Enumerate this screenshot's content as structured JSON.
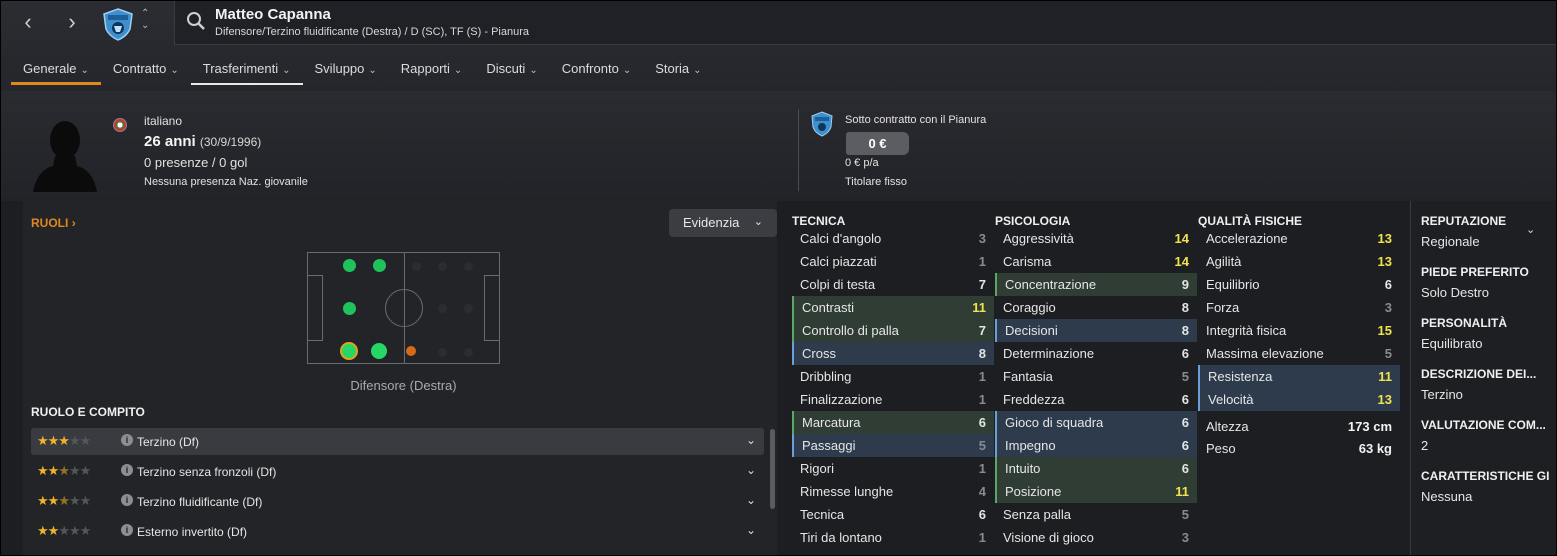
{
  "header": {
    "player_name": "Matteo Capanna",
    "player_roles": "Difensore/Terzino fluidificante (Destra) / D (SC), TF (S) - Pianura",
    "tabs": [
      {
        "label": "Generale"
      },
      {
        "label": "Contratto"
      },
      {
        "label": "Trasferimenti"
      },
      {
        "label": "Sviluppo"
      },
      {
        "label": "Rapporti"
      },
      {
        "label": "Discuti"
      },
      {
        "label": "Confronto"
      },
      {
        "label": "Storia"
      }
    ]
  },
  "profile": {
    "nationality": "italiano",
    "age": "26 anni",
    "birthdate": "(30/9/1996)",
    "appearances": "0 presenze / 0 gol",
    "youth_caps": "Nessuna presenza Naz. giovanile",
    "contract_with": "Sotto contratto con il Pianura",
    "value": "0 €",
    "wage": "0 € p/a",
    "squad_status": "Titolare fisso"
  },
  "roles_panel": {
    "title": "RUOLI",
    "highlight_button": "Evidenzia",
    "pitch_caption": "Difensore (Destra)",
    "role_section_title": "RUOLO E COMPITO",
    "roles": [
      {
        "name": "Terzino (Df)",
        "stars": 3
      },
      {
        "name": "Terzino senza fronzoli (Df)",
        "stars": 2.5
      },
      {
        "name": "Terzino fluidificante (Df)",
        "stars": 2.5
      },
      {
        "name": "Esterno invertito (Df)",
        "stars": 2
      }
    ]
  },
  "attributes": {
    "technical": {
      "title": "TECNICA",
      "items": [
        {
          "name": "Calci d'angolo",
          "value": "3"
        },
        {
          "name": "Calci piazzati",
          "value": "1"
        },
        {
          "name": "Colpi di testa",
          "value": "7"
        },
        {
          "name": "Contrasti",
          "value": "11"
        },
        {
          "name": "Controllo di palla",
          "value": "7"
        },
        {
          "name": "Cross",
          "value": "8"
        },
        {
          "name": "Dribbling",
          "value": "1"
        },
        {
          "name": "Finalizzazione",
          "value": "1"
        },
        {
          "name": "Marcatura",
          "value": "6"
        },
        {
          "name": "Passaggi",
          "value": "5"
        },
        {
          "name": "Rigori",
          "value": "1"
        },
        {
          "name": "Rimesse lunghe",
          "value": "4"
        },
        {
          "name": "Tecnica",
          "value": "6"
        },
        {
          "name": "Tiri da lontano",
          "value": "1"
        }
      ]
    },
    "mental": {
      "title": "PSICOLOGIA",
      "items": [
        {
          "name": "Aggressività",
          "value": "14"
        },
        {
          "name": "Carisma",
          "value": "14"
        },
        {
          "name": "Concentrazione",
          "value": "9"
        },
        {
          "name": "Coraggio",
          "value": "8"
        },
        {
          "name": "Decisioni",
          "value": "8"
        },
        {
          "name": "Determinazione",
          "value": "6"
        },
        {
          "name": "Fantasia",
          "value": "5"
        },
        {
          "name": "Freddezza",
          "value": "6"
        },
        {
          "name": "Gioco di squadra",
          "value": "6"
        },
        {
          "name": "Impegno",
          "value": "6"
        },
        {
          "name": "Intuito",
          "value": "6"
        },
        {
          "name": "Posizione",
          "value": "11"
        },
        {
          "name": "Senza palla",
          "value": "5"
        },
        {
          "name": "Visione di gioco",
          "value": "3"
        }
      ]
    },
    "physical": {
      "title": "QUALITÀ FISICHE",
      "items": [
        {
          "name": "Accelerazione",
          "value": "13"
        },
        {
          "name": "Agilità",
          "value": "13"
        },
        {
          "name": "Equilibrio",
          "value": "6"
        },
        {
          "name": "Forza",
          "value": "3"
        },
        {
          "name": "Integrità fisica",
          "value": "15"
        },
        {
          "name": "Massima elevazione",
          "value": "5"
        },
        {
          "name": "Resistenza",
          "value": "11"
        },
        {
          "name": "Velocità",
          "value": "13"
        }
      ],
      "height_label": "Altezza",
      "height": "173 cm",
      "weight_label": "Peso",
      "weight": "63 kg"
    }
  },
  "side_info": [
    {
      "label": "REPUTAZIONE",
      "value": "Regionale"
    },
    {
      "label": "PIEDE PREFERITO",
      "value": "Solo Destro"
    },
    {
      "label": "PERSONALITÀ",
      "value": "Equilibrato"
    },
    {
      "label": "DESCRIZIONE DEI...",
      "value": "Terzino"
    },
    {
      "label": "VALUTAZIONE COM...",
      "value": "2"
    },
    {
      "label": "CARATTERISTICHE GI",
      "value": "Nessuna"
    }
  ],
  "colors": {
    "accent": "#e0881f",
    "highlight_value": "#f0e34e",
    "green_row": "#2f3d35",
    "blue_row": "#2d3b4c"
  }
}
